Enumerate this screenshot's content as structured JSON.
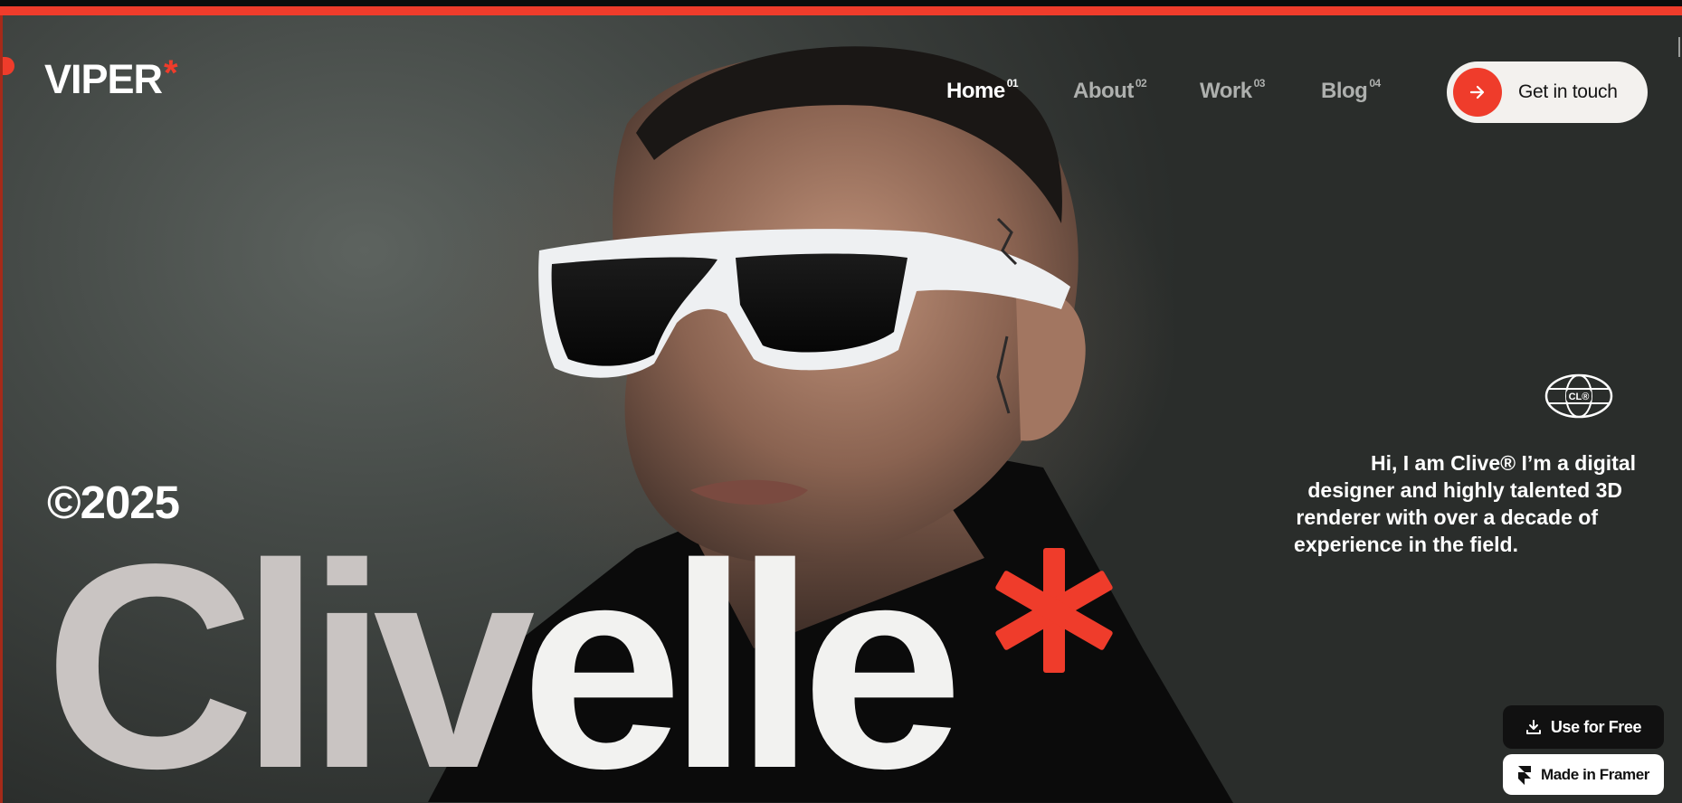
{
  "brand": {
    "logo_text": "VIPER",
    "logo_mark": "*",
    "accent": "#ef3c2b"
  },
  "nav": {
    "items": [
      {
        "label": "Home",
        "num": "01",
        "active": true
      },
      {
        "label": "About",
        "num": "02",
        "active": false
      },
      {
        "label": "Work",
        "num": "03",
        "active": false
      },
      {
        "label": "Blog",
        "num": "04",
        "active": false
      }
    ],
    "cta_label": "Get in touch",
    "cta_icon": "arrow-right-icon"
  },
  "hero": {
    "year": "©2025",
    "name_part1": "Cliv",
    "name_part2": "elle",
    "name_mark": "*",
    "globe_text": "CL®",
    "intro_lines": [
      "Hi, I am Clive® I’m a digital",
      "designer and highly talented 3D",
      "renderer with over a decade of",
      "experience in the field."
    ]
  },
  "badges": {
    "use_free_label": "Use for Free",
    "use_free_icon": "download-icon",
    "framer_label": "Made in Framer",
    "framer_icon": "framer-logo-icon"
  }
}
